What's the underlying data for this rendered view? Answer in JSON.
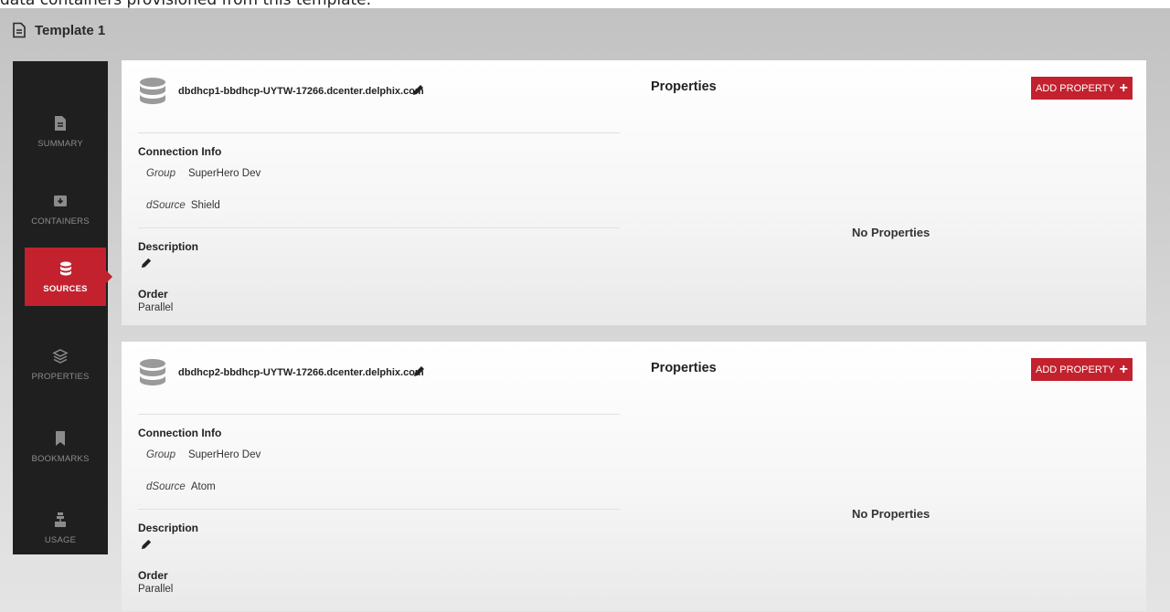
{
  "page": {
    "caption": "data containers provisioned from this template.",
    "title": "Template 1"
  },
  "sidebar": {
    "items": [
      {
        "label": "SUMMARY",
        "icon": "document-icon",
        "active": false
      },
      {
        "label": "CONTAINERS",
        "icon": "container-icon",
        "active": false
      },
      {
        "label": "SOURCES",
        "icon": "database-icon",
        "active": true
      },
      {
        "label": "PROPERTIES",
        "icon": "layers-icon",
        "active": false
      },
      {
        "label": "BOOKMARKS",
        "icon": "bookmark-icon",
        "active": false
      },
      {
        "label": "USAGE",
        "icon": "usage-icon",
        "active": false
      }
    ]
  },
  "sources": [
    {
      "host": "dbdhcp1-bbdhcp-UYTW-17266.dcenter.delphix.com",
      "connection_label": "Connection Info",
      "group_key": "Group",
      "group_value": "SuperHero Dev",
      "dsource_key": "dSource",
      "dsource_value": "Shield",
      "description_label": "Description",
      "order_label": "Order",
      "order_value": "Parallel",
      "properties_title": "Properties",
      "add_property_label": "ADD PROPERTY",
      "no_properties": "No Properties"
    },
    {
      "host": "dbdhcp2-bbdhcp-UYTW-17266.dcenter.delphix.com",
      "connection_label": "Connection Info",
      "group_key": "Group",
      "group_value": "SuperHero Dev",
      "dsource_key": "dSource",
      "dsource_value": "Atom",
      "description_label": "Description",
      "order_label": "Order",
      "order_value": "Parallel",
      "properties_title": "Properties",
      "add_property_label": "ADD PROPERTY",
      "no_properties": "No Properties"
    }
  ],
  "colors": {
    "accent": "#c3212e",
    "sidebar_bg": "#1f1f1f",
    "card_bg": "#ffffff"
  }
}
